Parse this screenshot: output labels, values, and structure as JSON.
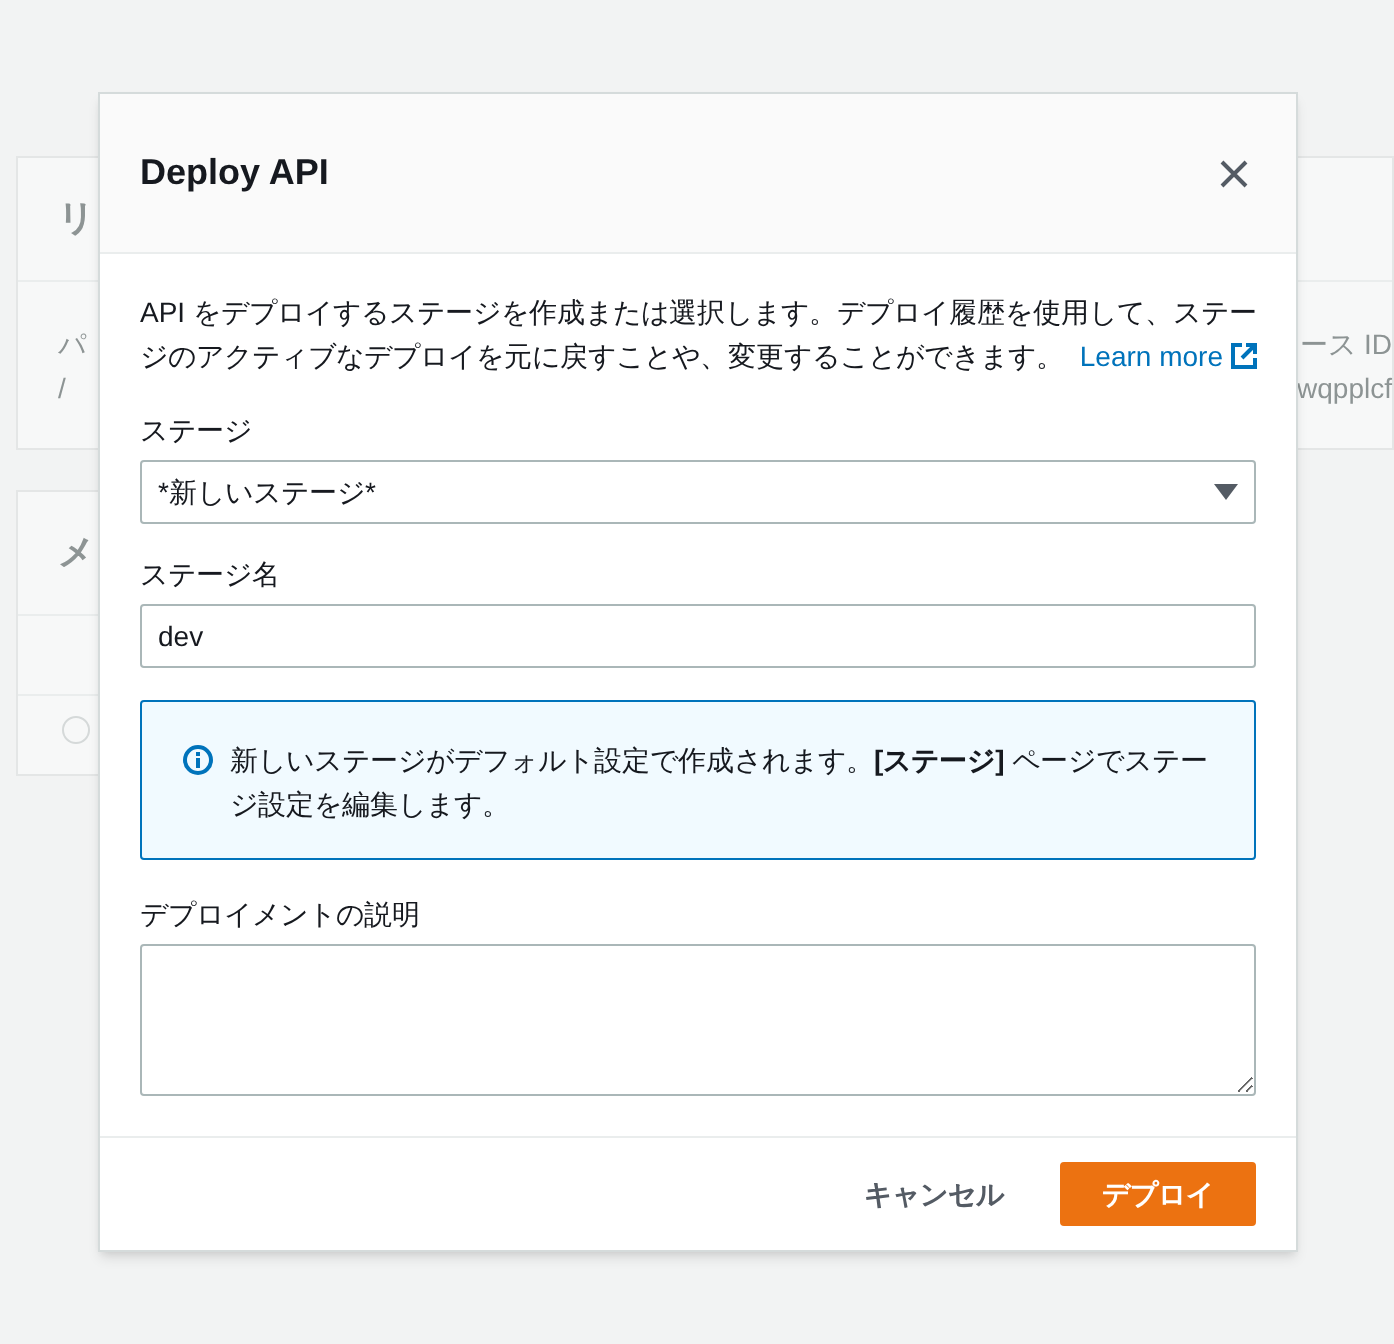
{
  "background": {
    "left_panels": [
      {
        "heading": "リ",
        "lines": [
          "パ",
          "/"
        ]
      },
      {
        "heading": "メ",
        "radio_selected": false
      }
    ],
    "right_panel": {
      "lines": [
        "ース ID",
        "wqpplcf"
      ]
    }
  },
  "dialog": {
    "title": "Deploy API",
    "description": "API をデプロイするステージを作成または選択します。デプロイ履歴を使用して、ステージのアクティブなデプロイを元に戻すことや、変更することができます。",
    "learn_more": "Learn more",
    "stage_label": "ステージ",
    "stage_value": "*新しいステージ*",
    "stage_name_label": "ステージ名",
    "stage_name_value": "dev",
    "info": "新しいステージがデフォルト設定で作成されます。**[ステージ]** ページでステージ設定を編集します。",
    "description_label": "デプロイメントの説明",
    "buttons": [
      {
        "label": "キャンセル",
        "kind": "secondary"
      },
      {
        "label": "デプロイ",
        "kind": "primary"
      }
    ]
  }
}
